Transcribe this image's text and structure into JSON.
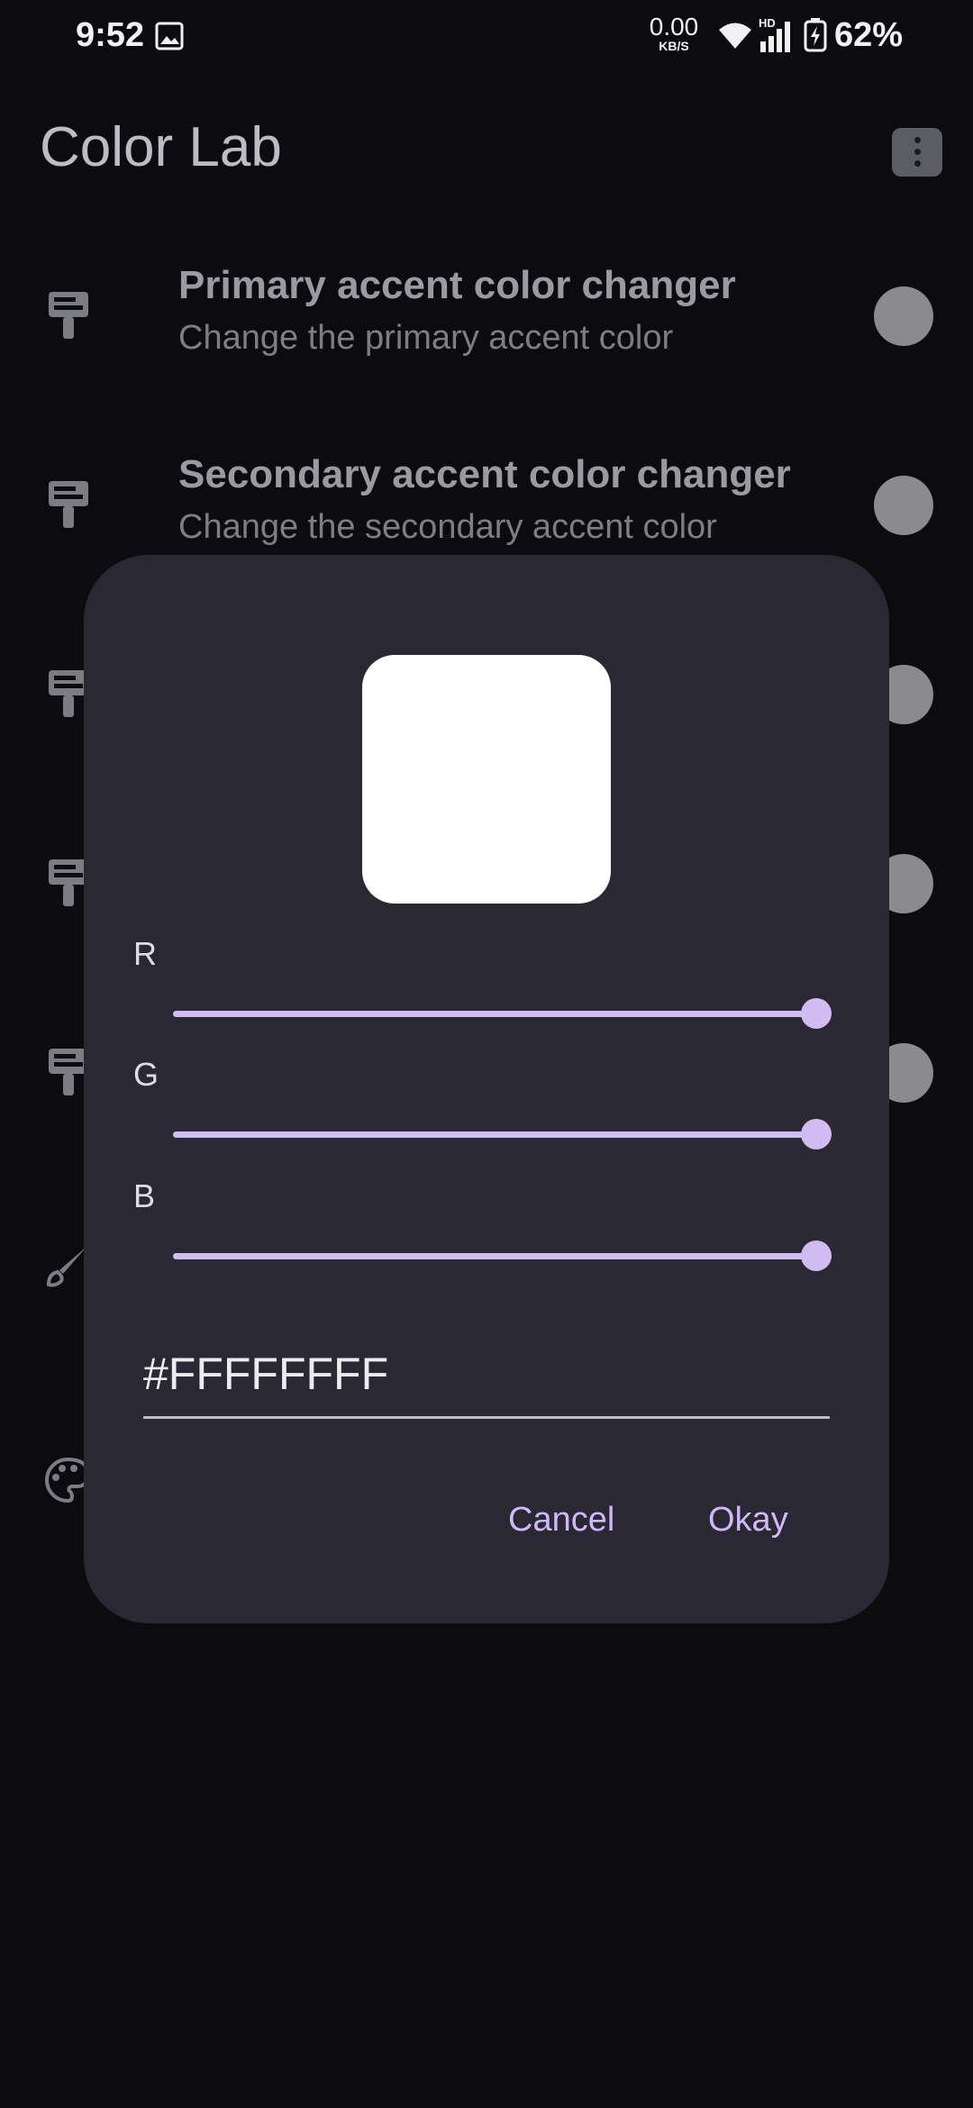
{
  "status_bar": {
    "time": "9:52",
    "net_speed": "0.00",
    "net_unit": "KB/S",
    "network_badge": "HD",
    "battery_percent": "62%"
  },
  "app": {
    "title": "Color Lab"
  },
  "list": {
    "items": [
      {
        "title": "Primary accent color changer",
        "subtitle": "Change the primary accent color"
      },
      {
        "title": "Secondary accent color changer",
        "subtitle": "Change the secondary accent color"
      },
      {
        "title": "",
        "subtitle": ""
      },
      {
        "title": "",
        "subtitle": ""
      },
      {
        "title": "",
        "subtitle": ""
      }
    ]
  },
  "dialog": {
    "preview_color": "#FFFFFF",
    "channels": [
      {
        "label": "R",
        "value": 255,
        "max": 255
      },
      {
        "label": "G",
        "value": 255,
        "max": 255
      },
      {
        "label": "B",
        "value": 255,
        "max": 255
      }
    ],
    "hex_value": "#FFFFFFFF",
    "cancel_label": "Cancel",
    "okay_label": "Okay"
  },
  "colors": {
    "accent": "#D0BCF0",
    "dialog_bg": "#2A2933",
    "background": "#0C0C10"
  }
}
